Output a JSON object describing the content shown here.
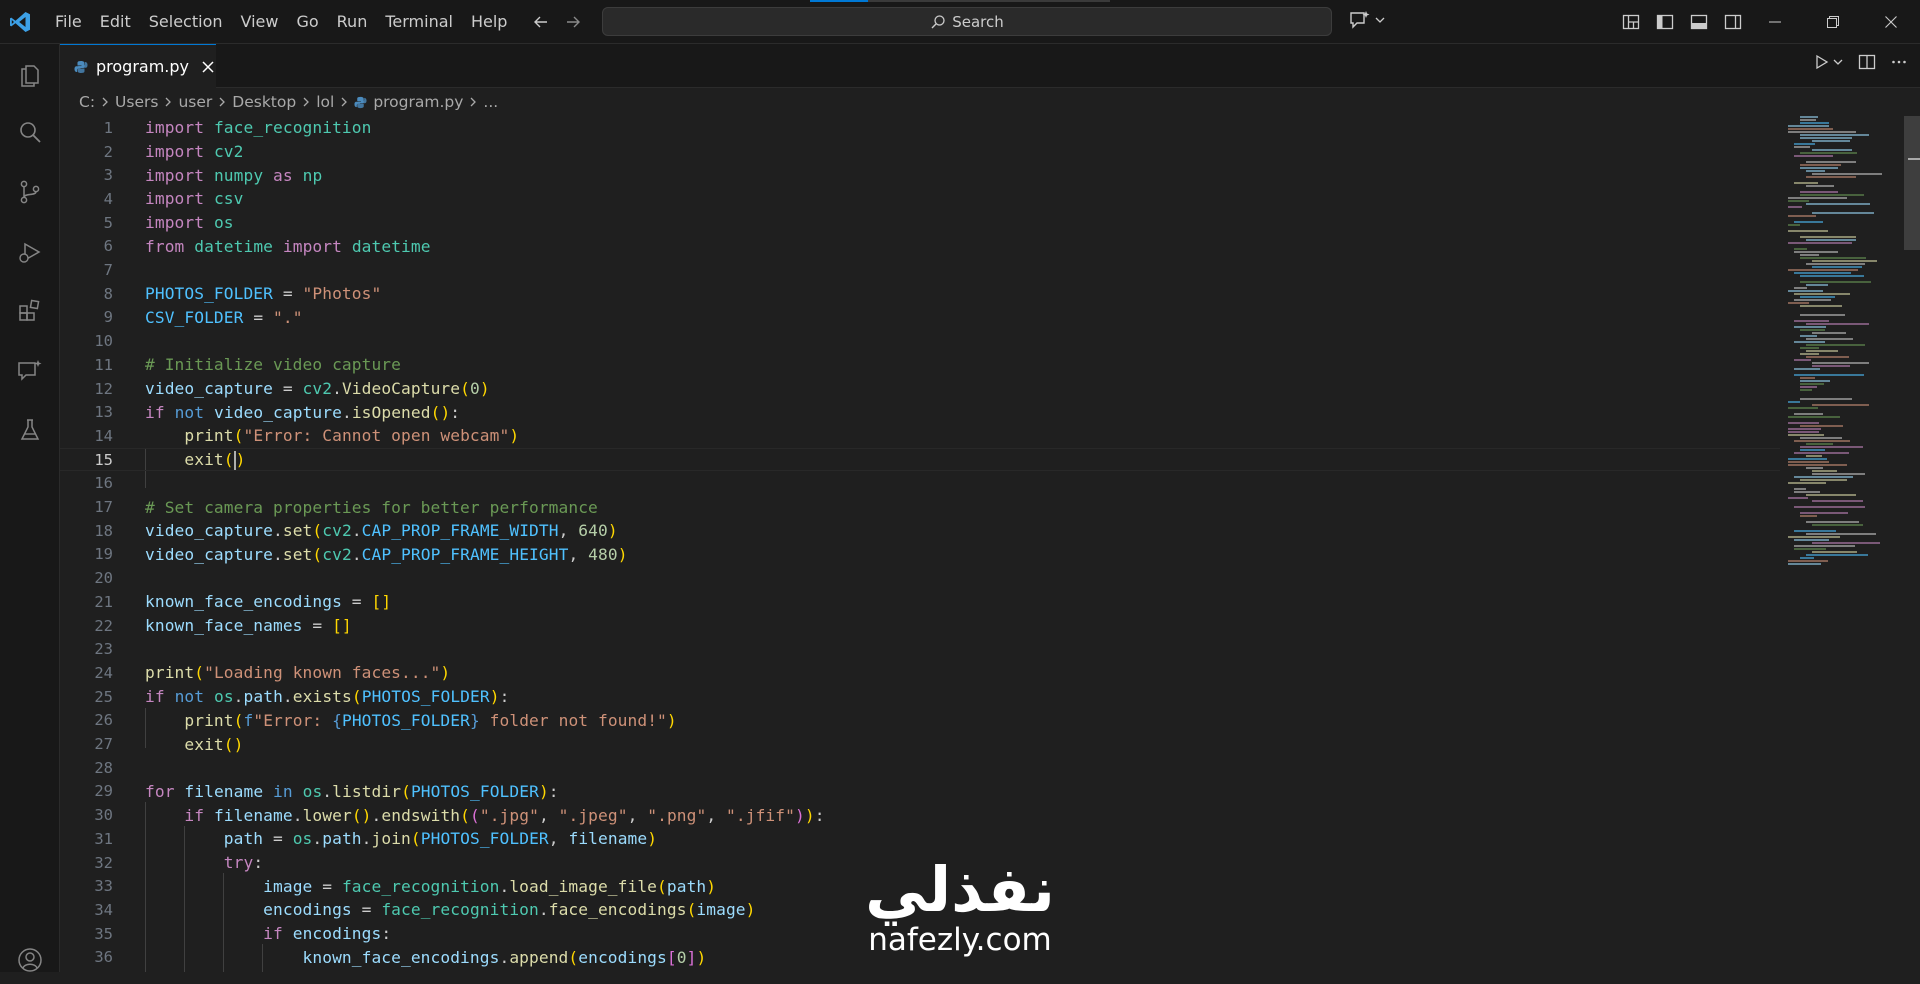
{
  "menu": [
    "File",
    "Edit",
    "Selection",
    "View",
    "Go",
    "Run",
    "Terminal",
    "Help"
  ],
  "search": {
    "label": "Search"
  },
  "colors": {
    "accent": "#0078d4",
    "logo": "#3ca0e6",
    "python_icon": "#4b8bbe"
  },
  "tab": {
    "label": "program.py"
  },
  "breadcrumb": [
    "C:",
    "Users",
    "user",
    "Desktop",
    "lol",
    "program.py",
    "..."
  ],
  "editor": {
    "current_line": 15,
    "lines": [
      [
        [
          "k",
          "import"
        ],
        [
          "t",
          " "
        ],
        [
          "m",
          "face_recognition"
        ]
      ],
      [
        [
          "k",
          "import"
        ],
        [
          "t",
          " "
        ],
        [
          "m",
          "cv2"
        ]
      ],
      [
        [
          "k",
          "import"
        ],
        [
          "t",
          " "
        ],
        [
          "m",
          "numpy"
        ],
        [
          "t",
          " "
        ],
        [
          "k",
          "as"
        ],
        [
          "t",
          " "
        ],
        [
          "m",
          "np"
        ]
      ],
      [
        [
          "k",
          "import"
        ],
        [
          "t",
          " "
        ],
        [
          "m",
          "csv"
        ]
      ],
      [
        [
          "k",
          "import"
        ],
        [
          "t",
          " "
        ],
        [
          "m",
          "os"
        ]
      ],
      [
        [
          "k",
          "from"
        ],
        [
          "t",
          " "
        ],
        [
          "m",
          "datetime"
        ],
        [
          "t",
          " "
        ],
        [
          "k",
          "import"
        ],
        [
          "t",
          " "
        ],
        [
          "m",
          "datetime"
        ]
      ],
      [],
      [
        [
          "cst",
          "PHOTOS_FOLDER"
        ],
        [
          "t",
          " = "
        ],
        [
          "s",
          "\"Photos\""
        ]
      ],
      [
        [
          "cst",
          "CSV_FOLDER"
        ],
        [
          "t",
          " = "
        ],
        [
          "s",
          "\".\""
        ]
      ],
      [],
      [
        [
          "c",
          "# Initialize video capture"
        ]
      ],
      [
        [
          "v",
          "video_capture"
        ],
        [
          "t",
          " = "
        ],
        [
          "m",
          "cv2"
        ],
        [
          "t",
          "."
        ],
        [
          "f",
          "VideoCapture"
        ],
        [
          "br1",
          "("
        ],
        [
          "n",
          "0"
        ],
        [
          "br1",
          ")"
        ]
      ],
      [
        [
          "k",
          "if"
        ],
        [
          "t",
          " "
        ],
        [
          "kb",
          "not"
        ],
        [
          "t",
          " "
        ],
        [
          "v",
          "video_capture"
        ],
        [
          "t",
          "."
        ],
        [
          "f",
          "isOpened"
        ],
        [
          "br1",
          "()"
        ],
        [
          "t",
          ":"
        ]
      ],
      [
        [
          "t",
          "    "
        ],
        [
          "f",
          "print"
        ],
        [
          "br1",
          "("
        ],
        [
          "s",
          "\"Error: Cannot open webcam\""
        ],
        [
          "br1",
          ")"
        ]
      ],
      [
        [
          "t",
          "    "
        ],
        [
          "f",
          "exit"
        ],
        [
          "br1",
          "("
        ],
        [
          "cur",
          ""
        ],
        [
          "br1",
          ")"
        ]
      ],
      [],
      [
        [
          "c",
          "# Set camera properties for better performance"
        ]
      ],
      [
        [
          "v",
          "video_capture"
        ],
        [
          "t",
          "."
        ],
        [
          "f",
          "set"
        ],
        [
          "br1",
          "("
        ],
        [
          "m",
          "cv2"
        ],
        [
          "t",
          "."
        ],
        [
          "cst",
          "CAP_PROP_FRAME_WIDTH"
        ],
        [
          "t",
          ", "
        ],
        [
          "n",
          "640"
        ],
        [
          "br1",
          ")"
        ]
      ],
      [
        [
          "v",
          "video_capture"
        ],
        [
          "t",
          "."
        ],
        [
          "f",
          "set"
        ],
        [
          "br1",
          "("
        ],
        [
          "m",
          "cv2"
        ],
        [
          "t",
          "."
        ],
        [
          "cst",
          "CAP_PROP_FRAME_HEIGHT"
        ],
        [
          "t",
          ", "
        ],
        [
          "n",
          "480"
        ],
        [
          "br1",
          ")"
        ]
      ],
      [],
      [
        [
          "v",
          "known_face_encodings"
        ],
        [
          "t",
          " = "
        ],
        [
          "br1",
          "[]"
        ]
      ],
      [
        [
          "v",
          "known_face_names"
        ],
        [
          "t",
          " = "
        ],
        [
          "br1",
          "[]"
        ]
      ],
      [],
      [
        [
          "f",
          "print"
        ],
        [
          "br1",
          "("
        ],
        [
          "s",
          "\"Loading known faces...\""
        ],
        [
          "br1",
          ")"
        ]
      ],
      [
        [
          "k",
          "if"
        ],
        [
          "t",
          " "
        ],
        [
          "kb",
          "not"
        ],
        [
          "t",
          " "
        ],
        [
          "m",
          "os"
        ],
        [
          "t",
          "."
        ],
        [
          "v",
          "path"
        ],
        [
          "t",
          "."
        ],
        [
          "f",
          "exists"
        ],
        [
          "br1",
          "("
        ],
        [
          "cst",
          "PHOTOS_FOLDER"
        ],
        [
          "br1",
          ")"
        ],
        [
          "t",
          ":"
        ]
      ],
      [
        [
          "t",
          "    "
        ],
        [
          "f",
          "print"
        ],
        [
          "br1",
          "("
        ],
        [
          "kb",
          "f"
        ],
        [
          "s",
          "\"Error: "
        ],
        [
          "kb",
          "{"
        ],
        [
          "cst",
          "PHOTOS_FOLDER"
        ],
        [
          "kb",
          "}"
        ],
        [
          "s",
          " folder not found!\""
        ],
        [
          "br1",
          ")"
        ]
      ],
      [
        [
          "t",
          "    "
        ],
        [
          "f",
          "exit"
        ],
        [
          "br1",
          "()"
        ]
      ],
      [],
      [
        [
          "k",
          "for"
        ],
        [
          "t",
          " "
        ],
        [
          "v",
          "filename"
        ],
        [
          "t",
          " "
        ],
        [
          "kb",
          "in"
        ],
        [
          "t",
          " "
        ],
        [
          "m",
          "os"
        ],
        [
          "t",
          "."
        ],
        [
          "f",
          "listdir"
        ],
        [
          "br1",
          "("
        ],
        [
          "cst",
          "PHOTOS_FOLDER"
        ],
        [
          "br1",
          ")"
        ],
        [
          "t",
          ":"
        ]
      ],
      [
        [
          "t",
          "    "
        ],
        [
          "k",
          "if"
        ],
        [
          "t",
          " "
        ],
        [
          "v",
          "filename"
        ],
        [
          "t",
          "."
        ],
        [
          "f",
          "lower"
        ],
        [
          "br1",
          "()"
        ],
        [
          "t",
          "."
        ],
        [
          "f",
          "endswith"
        ],
        [
          "br1",
          "("
        ],
        [
          "br2",
          "("
        ],
        [
          "s",
          "\".jpg\""
        ],
        [
          "t",
          ", "
        ],
        [
          "s",
          "\".jpeg\""
        ],
        [
          "t",
          ", "
        ],
        [
          "s",
          "\".png\""
        ],
        [
          "t",
          ", "
        ],
        [
          "s",
          "\".jfif\""
        ],
        [
          "br2",
          ")"
        ],
        [
          "br1",
          ")"
        ],
        [
          "t",
          ":"
        ]
      ],
      [
        [
          "t",
          "        "
        ],
        [
          "v",
          "path"
        ],
        [
          "t",
          " = "
        ],
        [
          "m",
          "os"
        ],
        [
          "t",
          "."
        ],
        [
          "v",
          "path"
        ],
        [
          "t",
          "."
        ],
        [
          "f",
          "join"
        ],
        [
          "br1",
          "("
        ],
        [
          "cst",
          "PHOTOS_FOLDER"
        ],
        [
          "t",
          ", "
        ],
        [
          "v",
          "filename"
        ],
        [
          "br1",
          ")"
        ]
      ],
      [
        [
          "t",
          "        "
        ],
        [
          "k",
          "try"
        ],
        [
          "t",
          ":"
        ]
      ],
      [
        [
          "t",
          "            "
        ],
        [
          "v",
          "image"
        ],
        [
          "t",
          " = "
        ],
        [
          "m",
          "face_recognition"
        ],
        [
          "t",
          "."
        ],
        [
          "f",
          "load_image_file"
        ],
        [
          "br1",
          "("
        ],
        [
          "v",
          "path"
        ],
        [
          "br1",
          ")"
        ]
      ],
      [
        [
          "t",
          "            "
        ],
        [
          "v",
          "encodings"
        ],
        [
          "t",
          " = "
        ],
        [
          "m",
          "face_recognition"
        ],
        [
          "t",
          "."
        ],
        [
          "f",
          "face_encodings"
        ],
        [
          "br1",
          "("
        ],
        [
          "v",
          "image"
        ],
        [
          "br1",
          ")"
        ]
      ],
      [
        [
          "t",
          "            "
        ],
        [
          "k",
          "if"
        ],
        [
          "t",
          " "
        ],
        [
          "v",
          "encodings"
        ],
        [
          "t",
          ":"
        ]
      ],
      [
        [
          "t",
          "                "
        ],
        [
          "v",
          "known_face_encodings"
        ],
        [
          "t",
          "."
        ],
        [
          "f",
          "append"
        ],
        [
          "br1",
          "("
        ],
        [
          "v",
          "encodings"
        ],
        [
          "br2",
          "["
        ],
        [
          "n",
          "0"
        ],
        [
          "br2",
          "]"
        ],
        [
          "br1",
          ")"
        ]
      ]
    ]
  },
  "watermark": {
    "arabic": "نفذلي",
    "latin": "nafezly.com"
  }
}
